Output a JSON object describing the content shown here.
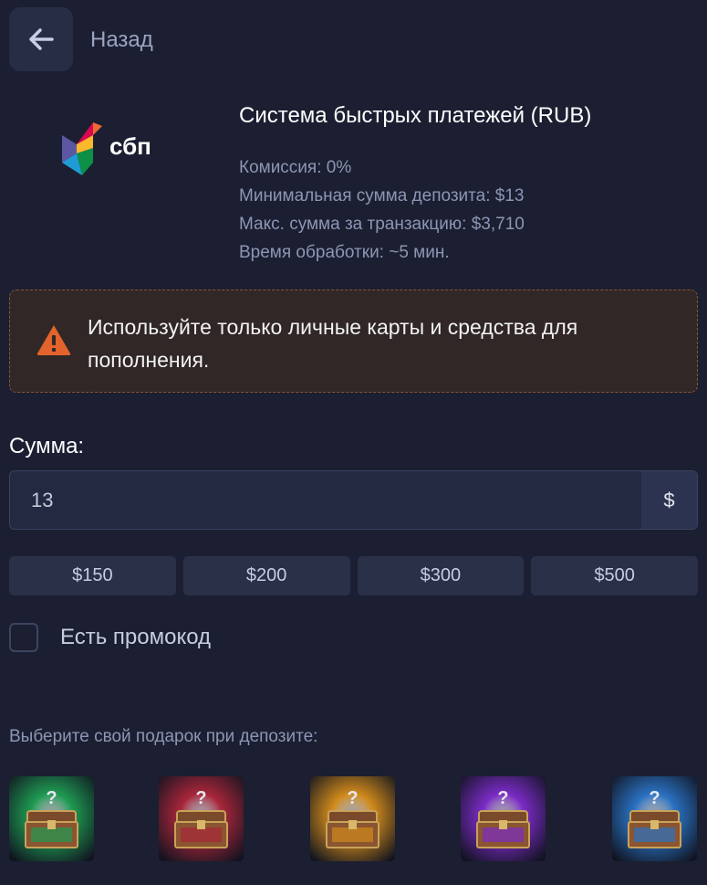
{
  "nav": {
    "back_label": "Назад"
  },
  "method": {
    "logo_text": "сбп",
    "title": "Система быстрых платежей (RUB)",
    "commission": "Комиссия: 0%",
    "min_deposit": "Минимальная сумма депозита: $13",
    "max_transaction": "Макс. сумма за транзакцию: $3,710",
    "processing_time": "Время обработки: ~5 мин."
  },
  "warning": {
    "text": "Используйте только личные карты и средства для пополнения."
  },
  "amount": {
    "label": "Сумма:",
    "value": "13",
    "currency": "$"
  },
  "quick_amounts": [
    "$150",
    "$200",
    "$300",
    "$500"
  ],
  "promo": {
    "label": "Есть промокод",
    "checked": false
  },
  "gifts": {
    "label": "Выберите свой подарок при депозите:",
    "colors": [
      "#1f9a52",
      "#a8263a",
      "#d08a1c",
      "#7a2bc4",
      "#2a72c2"
    ]
  },
  "colors": {
    "background": "#1b1f31",
    "warning_bg": "#302726",
    "warning_icon": "#e2642c"
  }
}
